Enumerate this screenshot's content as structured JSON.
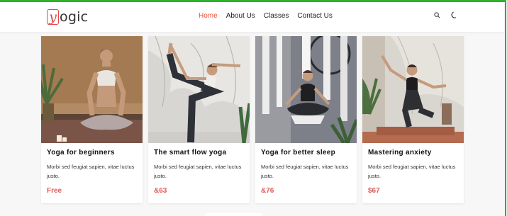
{
  "brand": {
    "mark": "y",
    "text": "ogic",
    "accent": "#e04848"
  },
  "nav": {
    "links": [
      {
        "label": "Home",
        "active": true
      },
      {
        "label": "About Us",
        "active": false
      },
      {
        "label": "Classes",
        "active": false
      },
      {
        "label": "Contact Us",
        "active": false
      }
    ],
    "icons": [
      "search-icon",
      "moon-icon"
    ]
  },
  "cards": [
    {
      "title": "Yoga for beginners",
      "description": "Morbi sed feugiat sapien, vitae luctus justo.",
      "price": "Free",
      "image": "woman-meditating-lotus-pose"
    },
    {
      "title": "The smart flow yoga",
      "description": "Morbi sed feugiat sapien, vitae luctus justo.",
      "price": "&63",
      "image": "woman-standing-dancer-pose"
    },
    {
      "title": "Yoga for better sleep",
      "description": "Morbi sed feugiat sapien, vitae luctus justo.",
      "price": "&76",
      "image": "woman-aerial-yoga-hammock"
    },
    {
      "title": "Mastering anxiety",
      "description": "Morbi sed feugiat sapien, vitae luctus justo.",
      "price": "$67",
      "image": "woman-balancing-pose-room"
    }
  ],
  "colors": {
    "price": "#e05a5a",
    "active_nav": "#e8543a",
    "frame": "#2db22d"
  }
}
